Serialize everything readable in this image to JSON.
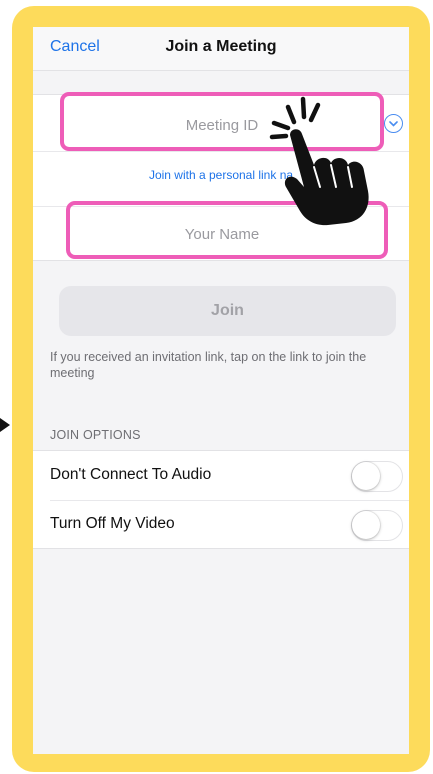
{
  "nav": {
    "cancel_label": "Cancel",
    "title": "Join a Meeting"
  },
  "meeting_id": {
    "placeholder": "Meeting ID",
    "value": ""
  },
  "personal_link": {
    "label": "Join with a personal link na"
  },
  "your_name": {
    "placeholder": "Your Name",
    "value": ""
  },
  "join_button": {
    "label": "Join"
  },
  "helper_text": "If you received an invitation link, tap on the link to join the meeting",
  "join_options": {
    "header": "JOIN OPTIONS",
    "items": [
      {
        "label": "Don't Connect To Audio",
        "enabled": false
      },
      {
        "label": "Turn Off My Video",
        "enabled": false
      }
    ]
  },
  "icons": {
    "chevron": "chevron-down-circle-icon",
    "pointer": "tap-hand-icon"
  },
  "colors": {
    "frame": "#FDDB5B",
    "highlight": "#EE5DB8",
    "link": "#1E73E8",
    "background": "#F4F4F6"
  }
}
